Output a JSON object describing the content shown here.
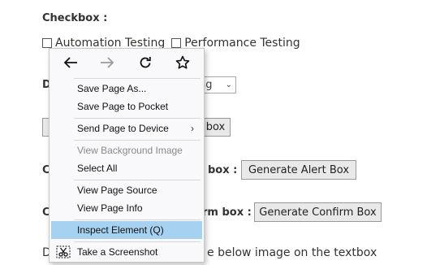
{
  "page": {
    "checkbox_heading": "Checkbox :",
    "checkbox_1": "Automation Testing",
    "checkbox_2": "Performance Testing",
    "dropdown_prefix": "D",
    "dropdown_value": "ng",
    "button_partial": "box",
    "row_c1_prefix": "C",
    "alert_label_tail": "box :",
    "alert_button": "Generate Alert Box",
    "row_c2_prefix": "C",
    "confirm_label_tail": "rm box :",
    "confirm_button": "Generate Confirm Box",
    "row_d_prefix": "D",
    "drag_text_tail": "e below image on the textbox"
  },
  "context_menu": {
    "nav": {
      "back_icon": "back-arrow-icon",
      "forward_icon": "forward-arrow-icon",
      "reload_icon": "reload-icon",
      "bookmark_icon": "star-icon"
    },
    "items": [
      {
        "label": "Save Page As...",
        "disabled": false
      },
      {
        "label": "Save Page to Pocket",
        "disabled": false
      },
      {
        "label": "Send Page to Device",
        "disabled": false,
        "submenu_arrow": "›"
      },
      {
        "label": "View Background Image",
        "disabled": true
      },
      {
        "label": "Select All",
        "disabled": false
      },
      {
        "label": "View Page Source",
        "disabled": false
      },
      {
        "label": "View Page Info",
        "disabled": false
      },
      {
        "label": "Inspect Element (Q)",
        "disabled": false,
        "highlighted": true
      },
      {
        "label": "Take a Screenshot",
        "disabled": false,
        "icon": "screenshot-scissors-icon"
      }
    ]
  },
  "colors": {
    "menu_highlight": "#a6d1f0",
    "menu_background": "#f9f9fb",
    "disabled_text": "#8a8a8a"
  }
}
